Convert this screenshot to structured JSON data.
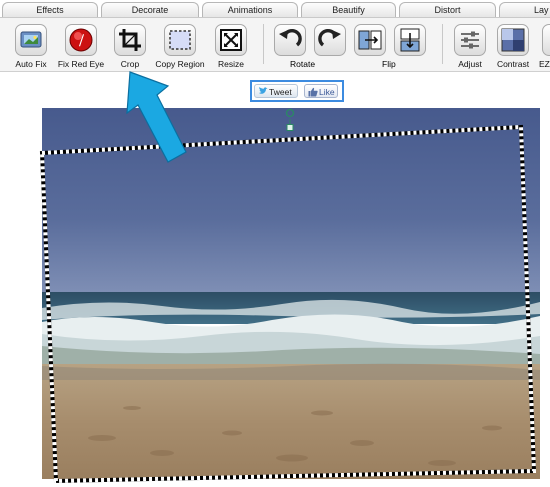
{
  "tabs": [
    "Effects",
    "Decorate",
    "Animations",
    "Beautify",
    "Distort",
    "Lay"
  ],
  "tools": {
    "auto_fix": "Auto Fix",
    "fix_red_eye": "Fix Red Eye",
    "crop": "Crop",
    "copy_region": "Copy Region",
    "resize": "Resize",
    "adjust": "Adjust",
    "contrast": "Contrast",
    "ez": "EZ"
  },
  "groups": {
    "rotate": "Rotate",
    "flip": "Flip"
  },
  "social": {
    "tweet": "Tweet",
    "like": "Like"
  },
  "colors": {
    "arrow": "#1ba8e2",
    "social_border": "#3c8be0",
    "red_eye": "#cc1111"
  }
}
